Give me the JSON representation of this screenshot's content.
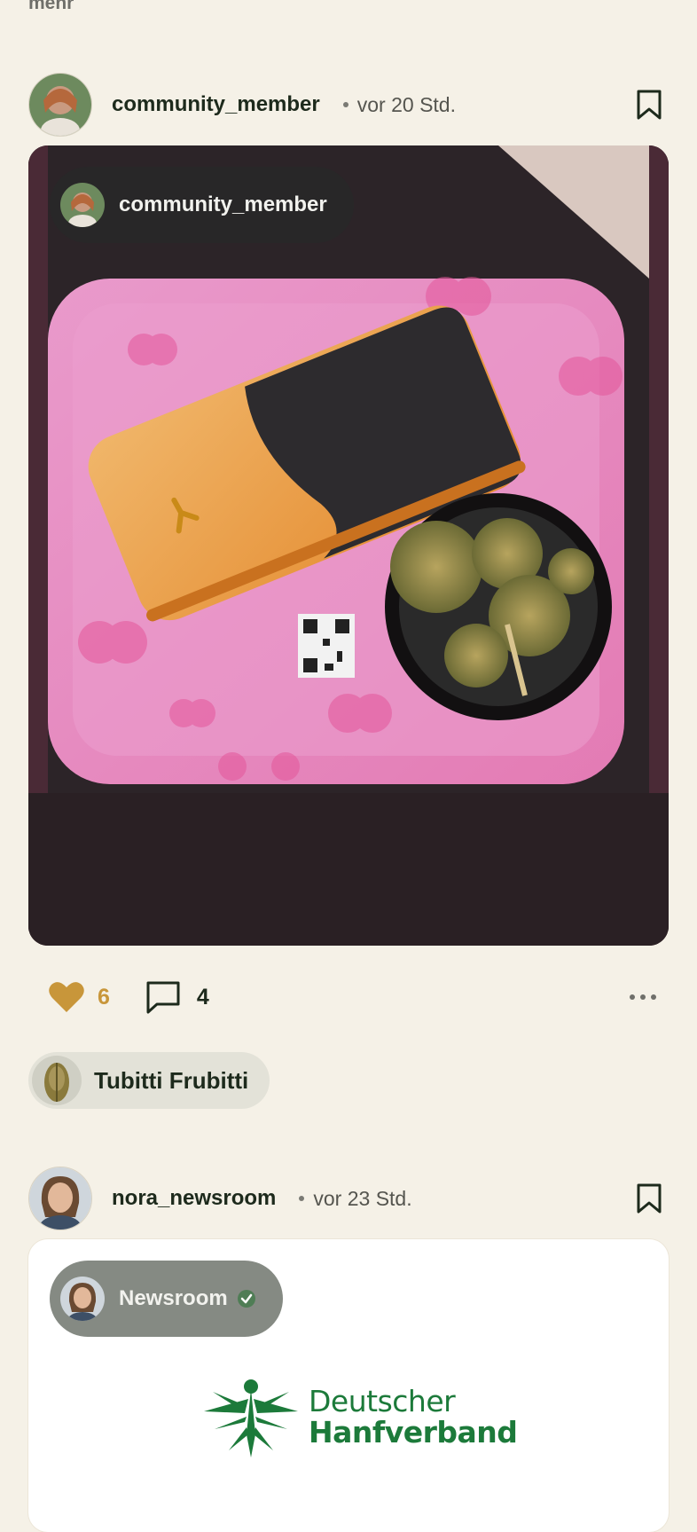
{
  "top": {
    "more_label": "mehr"
  },
  "posts": [
    {
      "username": "community_member",
      "time": "vor 20 Std.",
      "overlay_name": "community_member",
      "likes": "6",
      "comments": "4",
      "strain": "Tubitti Frubitti"
    },
    {
      "username": "nora_newsroom",
      "time": "vor 23 Std.",
      "overlay_name": "Newsroom",
      "logo_line1": "Deutscher",
      "logo_line2": "Hanfverband"
    }
  ],
  "icons": {
    "bookmark": "bookmark-icon",
    "heart": "heart-icon",
    "comment": "comment-icon",
    "more": "more-dots-icon",
    "verified": "verified-check-icon"
  },
  "colors": {
    "background": "#f5f1e7",
    "accent_gold": "#c8963a",
    "brand_green": "#1c7a3a"
  }
}
